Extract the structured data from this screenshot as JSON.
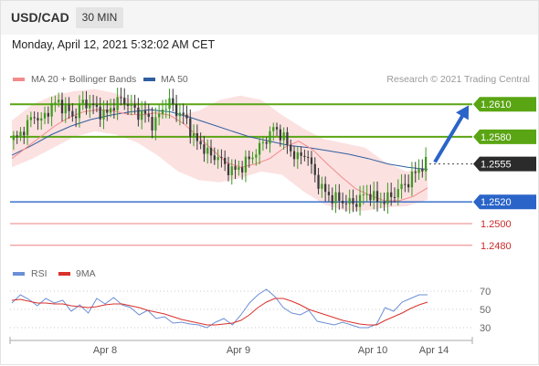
{
  "header": {
    "symbol": "USD/CAD",
    "timeframe": "30 MIN"
  },
  "timestamp": "Monday, April 12, 2021 5:32:02 AM CET",
  "legend": {
    "ma20": "MA 20 + Bollinger Bands",
    "ma50": "MA 50",
    "credit": "Research © 2021 Trading Central",
    "rsi": "RSI",
    "rsi_ma": "9MA"
  },
  "colors": {
    "ma20": "#f28b8b",
    "ma50": "#2f5f9e",
    "band": "#fbdcdc",
    "resistance": "#5aa513",
    "support": "#2a64c8",
    "support_lower": "#f08080",
    "arrow": "#2a64c8",
    "candle_up": "#3c9b1e",
    "candle_down": "#3a3a3a",
    "rsi": "#6b8fd6",
    "rsi_ma": "#d9312b"
  },
  "chart_data": [
    {
      "type": "candlestick",
      "instrument": "USD/CAD",
      "timeframe": "30 MIN",
      "x_tick_labels": [
        "Apr 8",
        "Apr 9",
        "Apr 10",
        "Apr 14"
      ],
      "ylim": [
        1.2463,
        1.2627
      ],
      "last_price": 1.2555,
      "levels": [
        {
          "label": "1.2610",
          "value": 1.261,
          "kind": "resistance"
        },
        {
          "label": "1.2580",
          "value": 1.258,
          "kind": "resistance"
        },
        {
          "label": "1.2555",
          "value": 1.2555,
          "kind": "last"
        },
        {
          "label": "1.2520",
          "value": 1.252,
          "kind": "support"
        },
        {
          "label": "1.2500",
          "value": 1.25,
          "kind": "support-minor"
        },
        {
          "label": "1.2480",
          "value": 1.248,
          "kind": "support-minor"
        }
      ],
      "forecast": {
        "from": 1.2555,
        "to": 1.261
      },
      "close_path": [
        1.2577,
        1.258,
        1.259,
        1.26,
        1.2594,
        1.2608,
        1.2612,
        1.2605,
        1.2598,
        1.2612,
        1.261,
        1.2604,
        1.26,
        1.261,
        1.2615,
        1.2608,
        1.2602,
        1.26,
        1.259,
        1.2606,
        1.2612,
        1.2602,
        1.2597,
        1.2578,
        1.2572,
        1.2562,
        1.2562,
        1.2552,
        1.2548,
        1.2553,
        1.256,
        1.2568,
        1.2578,
        1.2588,
        1.2582,
        1.2568,
        1.256,
        1.2566,
        1.2546,
        1.2532,
        1.2525,
        1.2522,
        1.252,
        1.2518,
        1.2525,
        1.2528,
        1.252,
        1.2522,
        1.2527,
        1.2534,
        1.254,
        1.255,
        1.2555
      ],
      "ma20_path": [
        1.256,
        1.257,
        1.258,
        1.259,
        1.2598,
        1.2603,
        1.2605,
        1.2604,
        1.2601,
        1.26,
        1.2602,
        1.26,
        1.2592,
        1.258,
        1.2568,
        1.2556,
        1.2552,
        1.2555,
        1.256,
        1.257,
        1.2576,
        1.2568,
        1.2555,
        1.2543,
        1.2532,
        1.2526,
        1.2521,
        1.2521,
        1.2525,
        1.2533
      ],
      "ma50_path": [
        1.2563,
        1.2572,
        1.2582,
        1.259,
        1.2596,
        1.26,
        1.2603,
        1.2605,
        1.2603,
        1.2598,
        1.2592,
        1.2586,
        1.258,
        1.2576,
        1.2572,
        1.257,
        1.2567,
        1.2564,
        1.256,
        1.2555,
        1.2552,
        1.255
      ],
      "band_upper": [
        1.2595,
        1.261,
        1.2618,
        1.2622,
        1.2624,
        1.262,
        1.2612,
        1.2604,
        1.26,
        1.2604,
        1.2614,
        1.2618,
        1.2614,
        1.26,
        1.2588,
        1.2578,
        1.2574,
        1.257,
        1.2556,
        1.2548,
        1.2552
      ],
      "band_lower": [
        1.2552,
        1.256,
        1.257,
        1.258,
        1.2585,
        1.2582,
        1.2575,
        1.2563,
        1.2548,
        1.254,
        1.2538,
        1.2542,
        1.2548,
        1.2545,
        1.253,
        1.2518,
        1.2512,
        1.2512,
        1.2515,
        1.2516,
        1.2522
      ]
    },
    {
      "type": "line",
      "title": "RSI",
      "y_tick_labels": [
        "70",
        "50",
        "30"
      ],
      "ylim": [
        20,
        80
      ],
      "series": [
        {
          "name": "RSI",
          "values": [
            57,
            66,
            61,
            54,
            62,
            57,
            60,
            48,
            55,
            46,
            62,
            56,
            63,
            55,
            52,
            44,
            49,
            40,
            42,
            35,
            36,
            34,
            33,
            30,
            36,
            40,
            33,
            44,
            57,
            66,
            72,
            64,
            52,
            46,
            44,
            49,
            37,
            35,
            33,
            36,
            33,
            30,
            30,
            34,
            52,
            48,
            58,
            62,
            66,
            66
          ]
        },
        {
          "name": "9MA",
          "values": [
            60,
            61,
            59,
            57,
            57,
            56,
            56,
            54,
            53,
            52,
            53,
            55,
            56,
            56,
            54,
            52,
            49,
            47,
            45,
            42,
            39,
            37,
            35,
            33,
            33,
            34,
            35,
            38,
            44,
            52,
            58,
            62,
            62,
            59,
            55,
            50,
            47,
            44,
            41,
            38,
            36,
            34,
            33,
            33,
            38,
            42,
            46,
            51,
            55,
            58
          ]
        }
      ]
    }
  ]
}
